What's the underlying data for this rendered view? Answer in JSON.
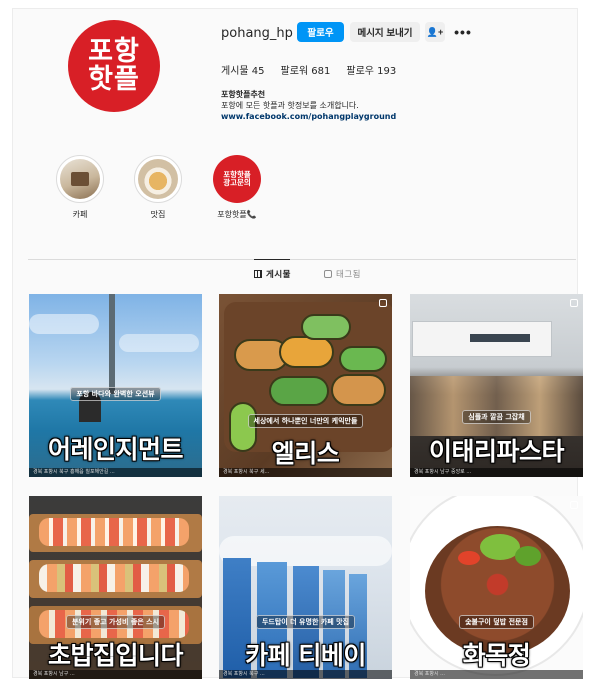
{
  "profile": {
    "avatar_line1": "포항",
    "avatar_line2": "핫플",
    "username": "pohang_hp",
    "follow_label": "팔로우",
    "message_label": "메시지 보내기",
    "suggest_label": "+",
    "more_label": "•••",
    "stats": {
      "posts": "게시물 45",
      "followers": "팔로워 681",
      "following": "팔로우 193"
    },
    "bio": {
      "name": "포항핫플추천",
      "description": "포항에 모든 핫플과 핫정보를 소개합니다.",
      "link": "www.facebook.com/pohangplayground"
    }
  },
  "highlights": [
    {
      "label": "카페",
      "icon": "cafe-thumb"
    },
    {
      "label": "맛집",
      "icon": "food-thumb"
    },
    {
      "label": "포항핫플📞",
      "inner_text": "포항핫플\n광고문의",
      "icon": "ad-thumb"
    }
  ],
  "tabs": [
    {
      "label": "게시물",
      "icon": "grid-icon",
      "active": true
    },
    {
      "label": "태그됨",
      "icon": "tag-icon",
      "active": false
    }
  ],
  "posts": [
    {
      "subtitle": "포항 바다와 완벽한 오션뷰",
      "title": "어레인지먼트",
      "footer": "경북 포항시 북구 흥해읍 칠포해안길 ..."
    },
    {
      "subtitle": "세상에서 하나뿐인 너만의 케익만들",
      "title": "엘리스",
      "footer": "경북 포항시 북구 세..."
    },
    {
      "subtitle": "심플과 깔끔 그잡채",
      "title": "이태리파스타",
      "footer": "경북 포항시 남구 중앙로 ..."
    },
    {
      "subtitle": "분위기 좋고 가성비 좋은 스시",
      "title": "초밥집입니다",
      "footer": "경북 포항시 남구 ..."
    },
    {
      "subtitle": "두드탑이 더 유명한 카페 맛집",
      "title": "카페 티베이",
      "footer": "경북 포항시 북구 ..."
    },
    {
      "subtitle": "숯불구이 덮밥 전문점",
      "title": "화목정",
      "footer": "경북 포항시 ..."
    }
  ],
  "colors": {
    "brand_red": "#d81f26",
    "follow_blue": "#0095f6",
    "link_blue": "#00376b"
  }
}
